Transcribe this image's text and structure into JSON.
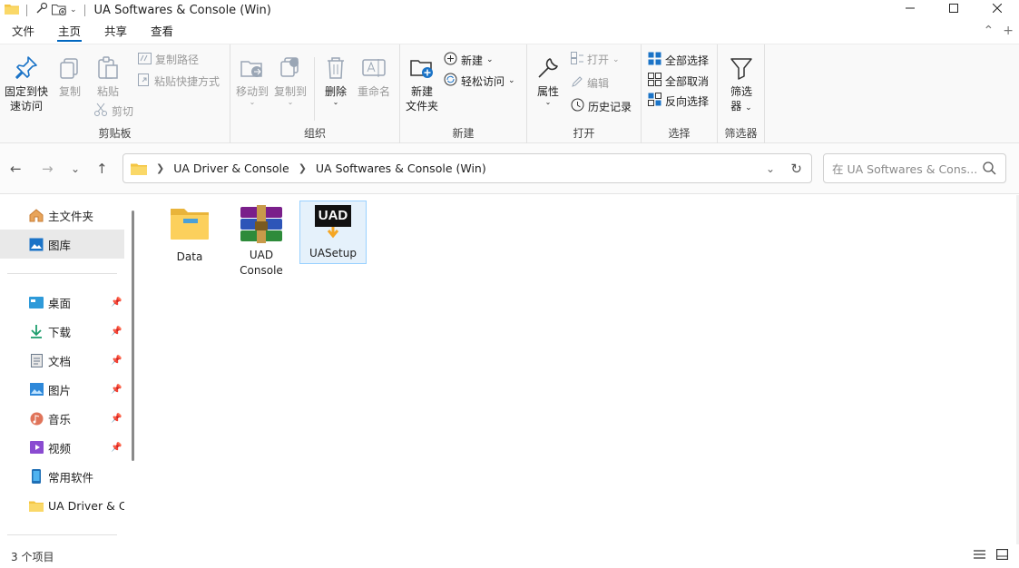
{
  "title": "UA Softwares & Console (Win)",
  "tabs": [
    "文件",
    "主页",
    "共享",
    "查看"
  ],
  "ribbon": {
    "clipboard": {
      "pin": "固定到快",
      "pin2": "速访问",
      "copy": "复制",
      "paste": "粘贴",
      "copy_path": "复制路径",
      "paste_shortcut": "粘贴快捷方式",
      "cut": "剪切",
      "label": "剪贴板"
    },
    "organize": {
      "move": "移动到",
      "copyto": "复制到",
      "delete": "删除",
      "rename": "重命名",
      "label": "组织"
    },
    "new": {
      "new_folder": "新建",
      "new_folder2": "文件夹",
      "new_item": "新建",
      "easy_access": "轻松访问",
      "label": "新建"
    },
    "open": {
      "props": "属性",
      "open": "打开",
      "edit": "编辑",
      "history": "历史记录",
      "label": "打开"
    },
    "select": {
      "all": "全部选择",
      "none": "全部取消",
      "invert": "反向选择",
      "label": "选择"
    },
    "filter": {
      "btn": "筛选",
      "btn2": "器",
      "label": "筛选器"
    }
  },
  "address": {
    "crumbs": [
      "UA Driver & Console",
      "UA Softwares & Console (Win)"
    ]
  },
  "search": {
    "placeholder": "在 UA Softwares & Cons..."
  },
  "sidebar": {
    "items": [
      {
        "label": "主文件夹",
        "icon": "home-icon"
      },
      {
        "label": "图库",
        "icon": "gallery-icon"
      },
      {
        "label": "桌面",
        "icon": "desktop-icon",
        "pinned": true
      },
      {
        "label": "下载",
        "icon": "download-icon",
        "pinned": true
      },
      {
        "label": "文档",
        "icon": "documents-icon",
        "pinned": true
      },
      {
        "label": "图片",
        "icon": "pictures-icon",
        "pinned": true
      },
      {
        "label": "音乐",
        "icon": "music-icon",
        "pinned": true
      },
      {
        "label": "视频",
        "icon": "videos-icon",
        "pinned": true
      },
      {
        "label": "常用软件",
        "icon": "phone-icon"
      },
      {
        "label": "UA Driver & Co",
        "icon": "folder-icon"
      }
    ]
  },
  "files": [
    {
      "name": "Data",
      "icon": "folder-icon"
    },
    {
      "name": "UAD Console",
      "line1": "UAD",
      "line2": "Console",
      "icon": "winrar-icon"
    },
    {
      "name": "UASetup",
      "icon": "uad-setup-icon",
      "badge": "UAD"
    }
  ],
  "status": {
    "count": "3 个项目"
  },
  "colors": {
    "accent": "#0067c0",
    "folder": "#f4c542",
    "selection": "#e5f1fb"
  }
}
